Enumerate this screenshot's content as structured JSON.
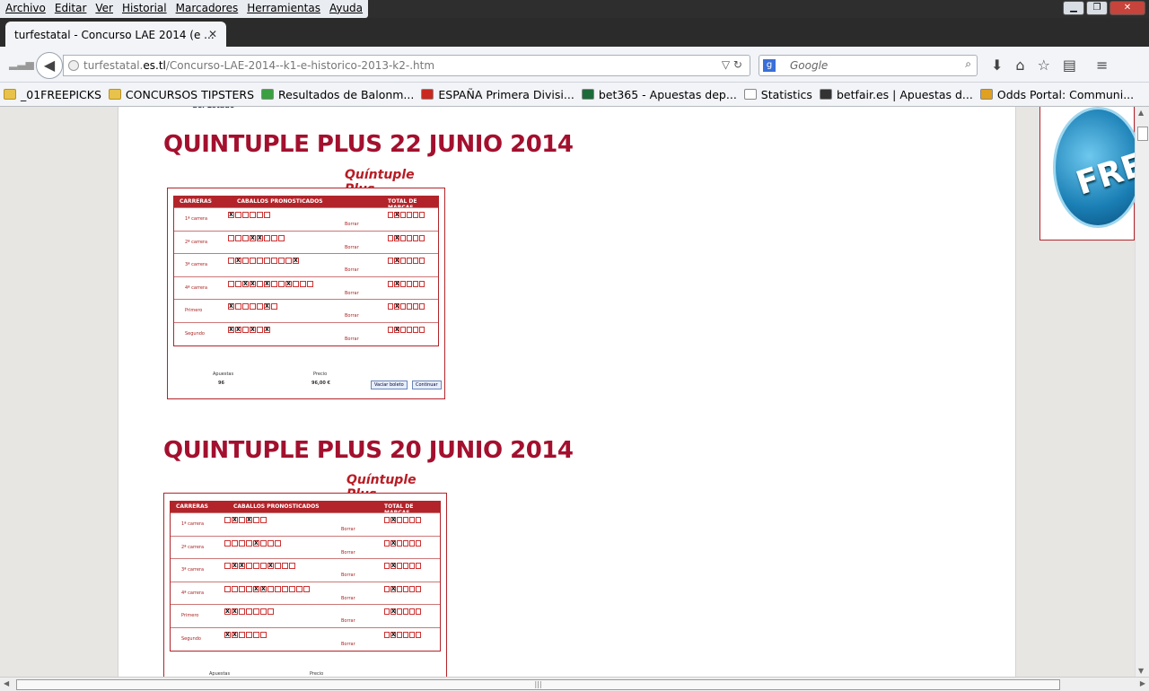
{
  "menu": [
    "Archivo",
    "Editar",
    "Ver",
    "Historial",
    "Marcadores",
    "Herramientas",
    "Ayuda"
  ],
  "tab": {
    "title": "turfestatal - Concurso LAE 2014 (e ..."
  },
  "url": {
    "prefix": "turfestatal.",
    "domain": "es.tl",
    "path": "/Concurso-LAE-2014--k1-e-historico-2013-k2-.htm"
  },
  "search": {
    "placeholder": "Google"
  },
  "bookmarks": [
    "_01FREEPICKS",
    "CONCURSOS TIPSTERS",
    "Resultados de Balonm...",
    "ESPAÑA Primera Divisi...",
    "bet365 - Apuestas dep...",
    "Statistics",
    "betfair.es | Apuestas d...",
    "Odds Portal: Communi..."
  ],
  "headings": [
    "QUINTUPLE PLUS 22 JUNIO 2014",
    "QUINTUPLE PLUS 20 JUNIO 2014"
  ],
  "ticket": {
    "logo": "Quíntuple Plus",
    "col1": "CARRERAS",
    "col2": "CABALLOS PRONOSTICADOS",
    "col3": "TOTAL DE MARCAS",
    "races": [
      "1ª carrera",
      "2ª carrera",
      "3ª carrera",
      "4ª carrera",
      "Primero",
      "Segundo"
    ],
    "borrar": "Borrar",
    "apuestas_label": "Apuestas",
    "apuestas": "96",
    "precio_label": "Precio",
    "precio": "96,00 €",
    "vaciar": "Vaciar boleto",
    "continuar": "Continuar"
  },
  "ad": {
    "text": "FREE"
  },
  "colors": {
    "heading": "#a3102e",
    "ticket_red": "#b2242a"
  }
}
